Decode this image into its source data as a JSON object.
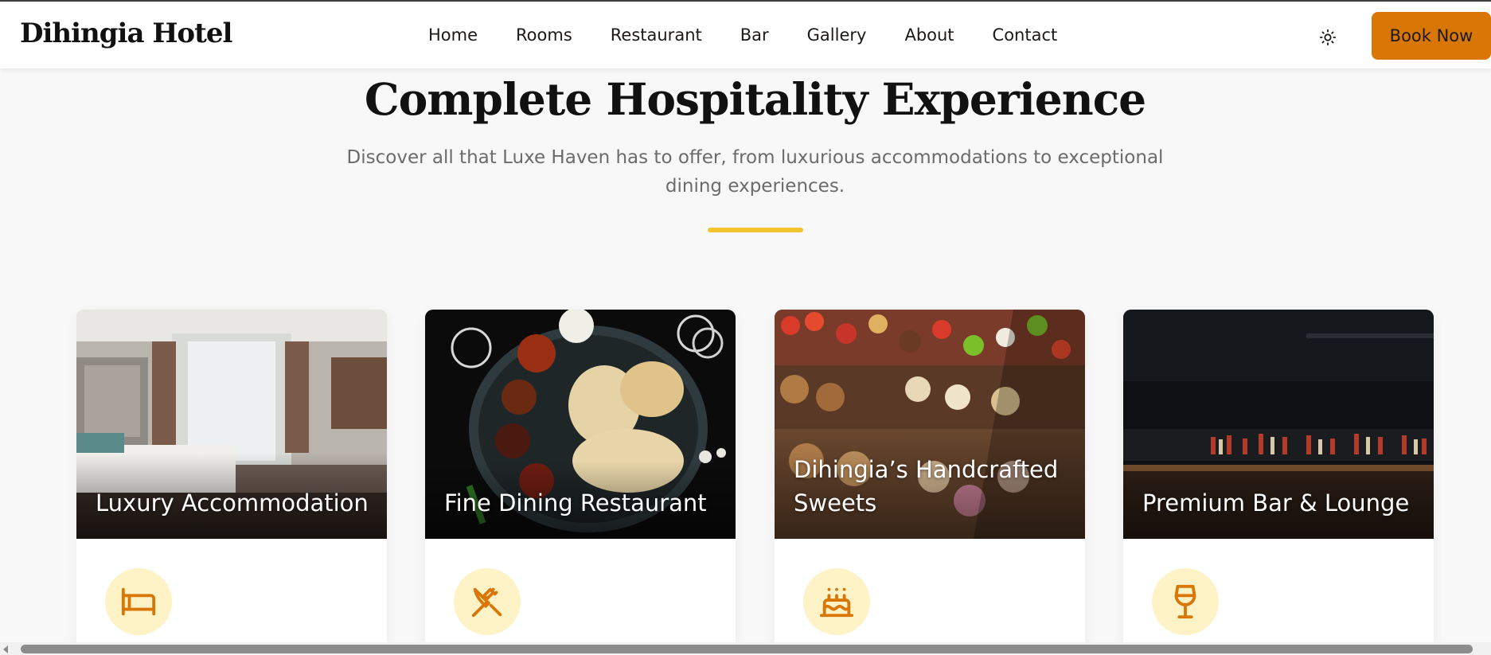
{
  "brand": {
    "name": "Dihingia Hotel"
  },
  "nav": {
    "links": [
      "Home",
      "Rooms",
      "Restaurant",
      "Bar",
      "Gallery",
      "About",
      "Contact"
    ],
    "theme_icon": "sun-icon",
    "book_label": "Book Now"
  },
  "hero": {
    "title": "Complete Hospitality Experience",
    "subtitle": "Discover all that Luxe Haven has to offer, from luxurious accommodations to exceptional dining experiences."
  },
  "cards": [
    {
      "title": "Luxury Accommodation",
      "icon": "bed-icon"
    },
    {
      "title": "Fine Dining Restaurant",
      "icon": "utensils-icon"
    },
    {
      "title": "Dihingia’s Handcrafted Sweets",
      "icon": "cake-icon"
    },
    {
      "title": "Premium Bar & Lounge",
      "icon": "wine-glass-icon"
    }
  ],
  "colors": {
    "accent": "#d97706",
    "accent_bar": "#f4c430",
    "icon_bg": "#fef3c7",
    "icon_fg": "#d97706"
  }
}
